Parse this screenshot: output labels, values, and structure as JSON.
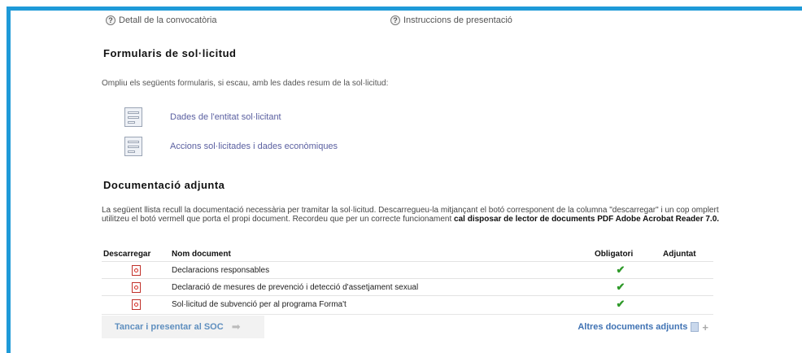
{
  "top_links": {
    "detall": "Detall de la convocatòria",
    "instruccions": "Instruccions de presentació"
  },
  "formularis": {
    "title": "Formularis de sol·licitud",
    "intro": "Ompliu els següents formularis, si escau, amb les dades resum de la sol·licitud:",
    "items": [
      {
        "label": "Dades de l'entitat sol·licitant"
      },
      {
        "label": "Accions sol·licitades i dades econòmiques"
      }
    ]
  },
  "documentacio": {
    "title": "Documentació adjunta",
    "text_part1": "La següent llista recull la documentació necessària per tramitar la sol·licitud. Descarregueu-la mitjançant el botó corresponent de la columna \"descarregar\" i un cop omplert utilitzeu el botó vermell que porta el propi document. Recordeu que per un correcte funcionament ",
    "text_bold": "cal disposar de lector de documents PDF Adobe Acrobat Reader 7.0."
  },
  "table": {
    "headers": {
      "descarregar": "Descarregar",
      "nom": "Nom document",
      "obligatori": "Obligatori",
      "adjuntat": "Adjuntat"
    },
    "rows": [
      {
        "nom": "Declaracions responsables",
        "obligatori": "✔"
      },
      {
        "nom": "Declaració de mesures de prevenció i detecció d'assetjament sexual",
        "obligatori": "✔"
      },
      {
        "nom": "Sol·licitud de subvenció per al programa Forma't",
        "obligatori": "✔"
      }
    ]
  },
  "actions": {
    "close": "Tancar i presentar al SOC",
    "altres": "Altres documents adjunts"
  },
  "colors": {
    "frame": "#1e9ad8",
    "link": "#5a5fa0",
    "check": "#2f9a2a",
    "pdf": "#d42a20"
  }
}
